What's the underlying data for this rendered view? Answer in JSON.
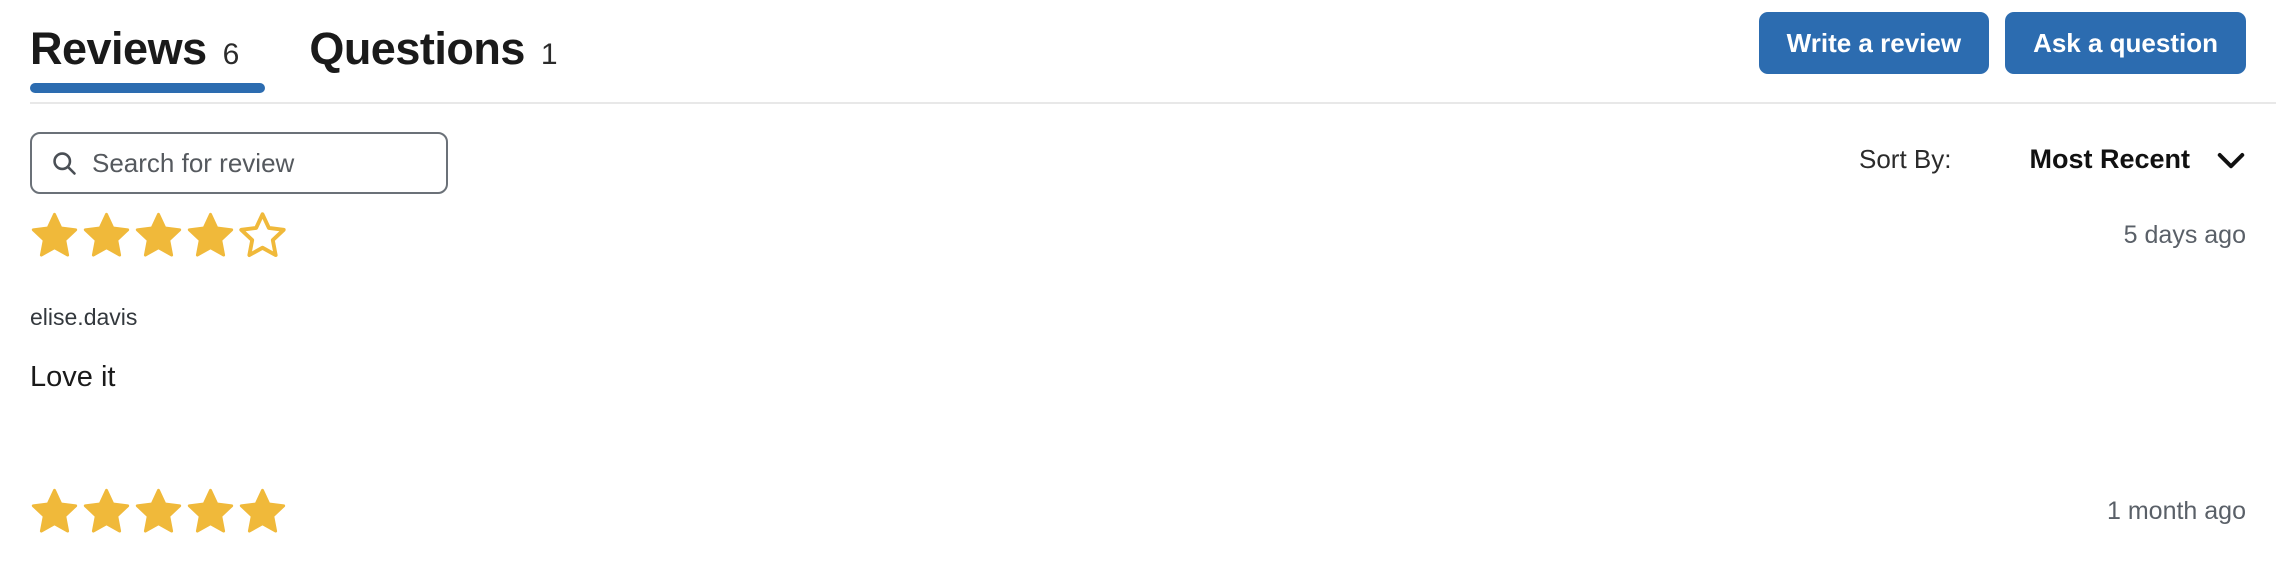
{
  "tabs": [
    {
      "label": "Reviews",
      "count": "6",
      "active": true,
      "name": "tab-reviews"
    },
    {
      "label": "Questions",
      "count": "1",
      "active": false,
      "name": "tab-questions"
    }
  ],
  "header": {
    "write_review_label": "Write a review",
    "ask_question_label": "Ask a question"
  },
  "search": {
    "placeholder": "Search for review",
    "value": "",
    "icon": "search-icon"
  },
  "sort": {
    "label": "Sort By:",
    "value": "Most Recent",
    "icon": "chevron-down-icon"
  },
  "reviews": [
    {
      "rating": 4,
      "max_rating": 5,
      "age": "5 days ago",
      "author": "elise.davis",
      "body": "Love it"
    },
    {
      "rating": 5,
      "max_rating": 5,
      "age": "1 month ago",
      "author": "",
      "body": ""
    }
  ],
  "colors": {
    "accent": "#2c6cb0",
    "star_filled": "#f0b93a",
    "star_empty": "#f0b93a",
    "divider": "#e8e8e8",
    "text": "#1a1a1a"
  }
}
